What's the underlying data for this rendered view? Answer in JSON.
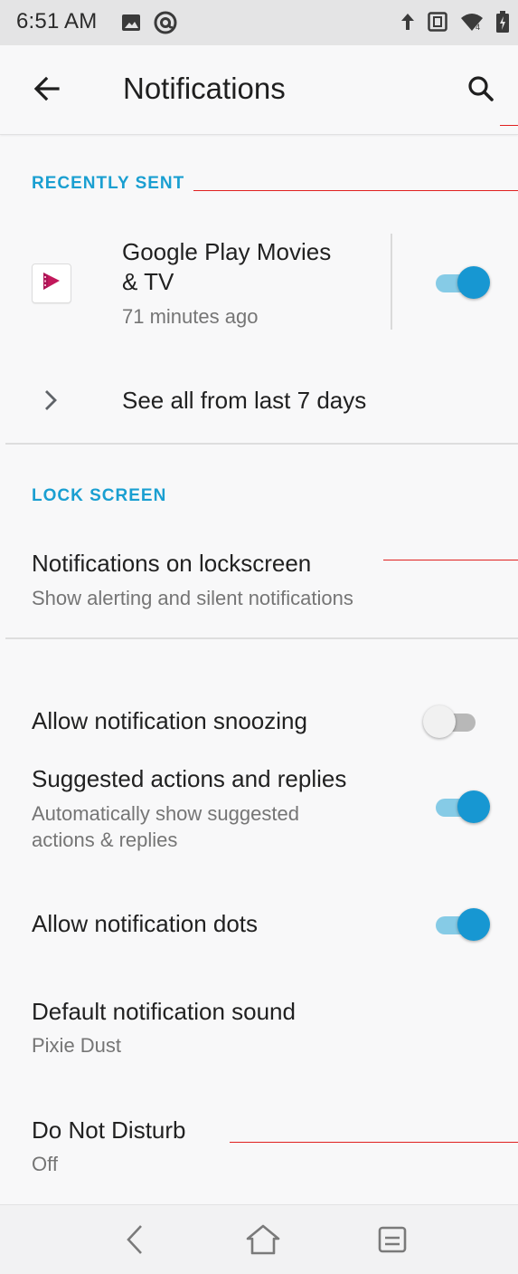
{
  "status_bar": {
    "time": "6:51 AM",
    "icons": [
      "image-icon",
      "at-sign-icon",
      "upload-arrow-icon",
      "nfc-icon",
      "wifi-icon",
      "battery-charging-icon"
    ]
  },
  "app_bar": {
    "title": "Notifications",
    "back_icon": "arrow-left-icon",
    "search_icon": "search-icon"
  },
  "recently_sent": {
    "header": "RECENTLY SENT",
    "app": {
      "name": "Google Play Movies & TV",
      "name_line1": "Google Play Movies",
      "name_line2": "& TV",
      "time": "71 minutes ago",
      "enabled": true
    },
    "see_all": "See all from last 7 days"
  },
  "lock_screen": {
    "header": "LOCK SCREEN",
    "title": "Notifications on lockscreen",
    "summary": "Show alerting and silent notifications"
  },
  "settings": {
    "snoozing": {
      "title": "Allow notification snoozing",
      "enabled": false
    },
    "suggested": {
      "title": "Suggested actions and replies",
      "summary_line1": "Automatically show suggested",
      "summary_line2": "actions & replies",
      "enabled": true
    },
    "dots": {
      "title": "Allow notification dots",
      "enabled": true
    },
    "sound": {
      "title": "Default notification sound",
      "value": "Pixie Dust"
    },
    "dnd": {
      "title": "Do Not Disturb",
      "value": "Off"
    }
  },
  "nav_bar": {
    "icons": [
      "nav-back-icon",
      "nav-home-icon",
      "nav-recents-icon"
    ]
  },
  "colors": {
    "accent": "#1a9fd1",
    "toggle_on_thumb": "#1797d2",
    "toggle_on_track": "#86cbe6",
    "annotation_red": "#e02020",
    "app_icon_red": "#c2185b"
  }
}
